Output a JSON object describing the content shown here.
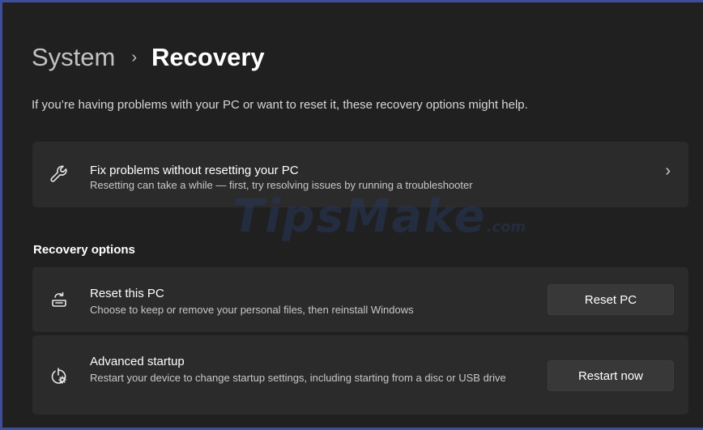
{
  "breadcrumb": {
    "parent": "System",
    "separator": "›",
    "current": "Recovery"
  },
  "subtitle": "If you’re having problems with your PC or want to reset it, these recovery options might help.",
  "fix_card": {
    "icon": "wrench-icon",
    "title": "Fix problems without resetting your PC",
    "description": "Resetting can take a while — first, try resolving issues by running a troubleshooter",
    "chevron": "›"
  },
  "section_title": "Recovery options",
  "reset_card": {
    "icon": "reset-pc-icon",
    "title": "Reset this PC",
    "description": "Choose to keep or remove your personal files, then reinstall Windows",
    "button": "Reset PC"
  },
  "advanced_card": {
    "icon": "advanced-startup-icon",
    "title": "Advanced startup",
    "description": "Restart your device to change startup settings, including starting from a disc or USB drive",
    "button": "Restart now"
  },
  "watermark": {
    "text": "TipsMake",
    "suffix": ".com"
  },
  "colors": {
    "background": "#202020",
    "card": "#2b2b2b",
    "button": "#383838",
    "frame_border": "#3f4e9b"
  }
}
